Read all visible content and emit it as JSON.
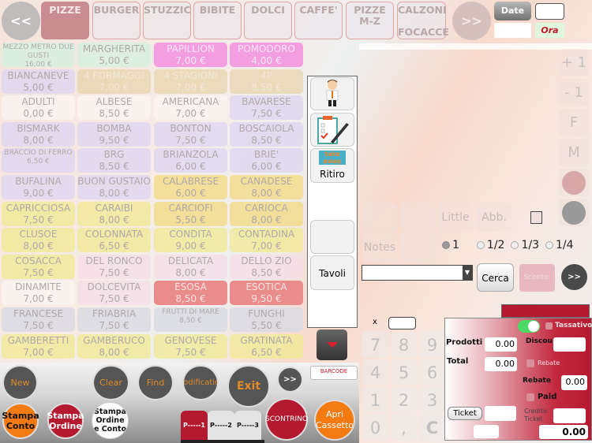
{
  "nav": {
    "prev": "<<",
    "next": ">>"
  },
  "categories": [
    "PIZZE",
    "BURGER",
    "STUZZIC",
    "BIBITE",
    "DOLCI",
    "CAFFE'",
    "PIZZE\nM-Z",
    "CALZONI\n\nFOCACCE"
  ],
  "datetime": {
    "date_label": "Date",
    "date_value": "",
    "time_label": "Ora",
    "time_value": ""
  },
  "products": [
    {
      "name": "MEZZO METRO DUE GUSTI",
      "price": "16,00 €",
      "c": "c-green",
      "s": 1
    },
    {
      "name": "MARGHERITA",
      "price": "5,00 €",
      "c": "c-green"
    },
    {
      "name": "PAPILLION",
      "price": "7,00 €",
      "c": "c-pink"
    },
    {
      "name": "POMODORO",
      "price": "4,00 €",
      "c": "c-pink"
    },
    {
      "name": "BIANCANEVE",
      "price": "5,00 €",
      "c": "c-lav"
    },
    {
      "name": "4 FORMAGGI",
      "price": "7,00 €",
      "c": "c-tan"
    },
    {
      "name": "4 STAGIONI",
      "price": "7,00 €",
      "c": "c-tan"
    },
    {
      "name": "4P",
      "price": "8,50 €",
      "c": "c-tan"
    },
    {
      "name": "ADULTI",
      "price": "0,00 €",
      "c": "c-white"
    },
    {
      "name": "ALBESE",
      "price": "8,50 €",
      "c": "c-white"
    },
    {
      "name": "AMERICANA",
      "price": "7,00 €",
      "c": "c-white"
    },
    {
      "name": "BAVARESE",
      "price": "7,50 €",
      "c": "c-lav"
    },
    {
      "name": "BISMARK",
      "price": "8,00 €",
      "c": "c-lav"
    },
    {
      "name": "BOMBA",
      "price": "9,50 €",
      "c": "c-lav"
    },
    {
      "name": "BONTON",
      "price": "7,50 €",
      "c": "c-lav"
    },
    {
      "name": "BOSCAIOLA",
      "price": "8,50 €",
      "c": "c-lav"
    },
    {
      "name": "BRACCIO DI FERRO",
      "price": "6,50 €",
      "c": "c-lav",
      "s": 1
    },
    {
      "name": "BRG",
      "price": "8,50 €",
      "c": "c-lav"
    },
    {
      "name": "BRIANZOLA",
      "price": "6,00 €",
      "c": "c-lav"
    },
    {
      "name": "BRIE'",
      "price": "6,00 €",
      "c": "c-lav"
    },
    {
      "name": "BUFALINA",
      "price": "9,00 €",
      "c": "c-lav"
    },
    {
      "name": "BUON GUSTAIO",
      "price": "8,00 €",
      "c": "c-lav"
    },
    {
      "name": "CALABRESE",
      "price": "6,00 €",
      "c": "c-yel2"
    },
    {
      "name": "CANADESE",
      "price": "8,00 €",
      "c": "c-yel2"
    },
    {
      "name": "CAPRICCIOSA",
      "price": "7,50 €",
      "c": "c-yel"
    },
    {
      "name": "CARAIBI",
      "price": "8,00 €",
      "c": "c-yel"
    },
    {
      "name": "CARCIOFI",
      "price": "5,50 €",
      "c": "c-yel2"
    },
    {
      "name": "CARIOCA",
      "price": "8,00 €",
      "c": "c-yel2"
    },
    {
      "name": "CLUSOE",
      "price": "8,00 €",
      "c": "c-yel"
    },
    {
      "name": "COLONNATA",
      "price": "6,50 €",
      "c": "c-yel"
    },
    {
      "name": "CONDITA",
      "price": "9,00 €",
      "c": "c-yel"
    },
    {
      "name": "CONTADINA",
      "price": "7,00 €",
      "c": "c-yel"
    },
    {
      "name": "COSACCA",
      "price": "7,50 €",
      "c": "c-yel"
    },
    {
      "name": "DEL RONCO",
      "price": "7,50 €",
      "c": "c-rose"
    },
    {
      "name": "DELICATA",
      "price": "8,00 €",
      "c": "c-rose"
    },
    {
      "name": "DELLO ZIO",
      "price": "8,50 €",
      "c": "c-rose"
    },
    {
      "name": "DINAMITE",
      "price": "7,00 €",
      "c": "c-white"
    },
    {
      "name": "DOLCEVITA",
      "price": "7,50 €",
      "c": "c-rose"
    },
    {
      "name": "ESOSA",
      "price": "8,50 €",
      "c": "c-red"
    },
    {
      "name": "ESOTICA",
      "price": "9,50 €",
      "c": "c-red"
    },
    {
      "name": "FRANCESE",
      "price": "7,50 €",
      "c": "c-grey"
    },
    {
      "name": "FRIABRIA",
      "price": "7,50 €",
      "c": "c-grey"
    },
    {
      "name": "FRUTTI DI MARE",
      "price": "8,50 €",
      "c": "c-grey",
      "s": 1
    },
    {
      "name": "FUNGHI",
      "price": "5,50 €",
      "c": "c-grey"
    },
    {
      "name": "GAMBERETTI",
      "price": "7,00 €",
      "c": "c-yel"
    },
    {
      "name": "GAMBERUCO",
      "price": "8,00 €",
      "c": "c-yel"
    },
    {
      "name": "GENOVESE",
      "price": "7,50 €",
      "c": "c-yel"
    },
    {
      "name": "GRATINATA",
      "price": "6,50 €",
      "c": "c-yel"
    }
  ],
  "side_panel": {
    "ritiro": "Ritiro",
    "tavoli": "Tavoli",
    "icons": [
      "waiter-icon",
      "clipboard-pen-icon",
      "takeaway-icon"
    ],
    "takeaway_text": "take away"
  },
  "right_buttons": [
    "+ 1",
    "- 1",
    "F",
    "M"
  ],
  "modifiers": {
    "little": "Little",
    "abb": "Abb.",
    "notes": "Notes",
    "fractions": [
      "1",
      "1/2",
      "1/3",
      "1/4"
    ],
    "selected_fraction": "1"
  },
  "search": {
    "cerca": "Cerca",
    "sconto": "Sconto:",
    "next": ">>"
  },
  "keypad": {
    "x_label": "x",
    "keys": [
      "7",
      "8",
      "9",
      "4",
      "5",
      "6",
      "1",
      "2",
      "3",
      "0",
      ",",
      "C"
    ]
  },
  "totals": {
    "tassativo": "Tassativo",
    "prodotti_label": "Prodotti",
    "prodotti": "0.00",
    "discount_label": "Discou",
    "total_label": "Total",
    "total": "0.00",
    "rebate_check": "Rebate",
    "rebate_label": "Rebate",
    "rebate": "0.00",
    "paid": "Paid",
    "ticket": "Ticket",
    "credito_ticket": "Credito\nTicket",
    "grand_total": "0.00",
    "toggle_on": true
  },
  "toolbar": {
    "new": "New",
    "clear": "Clear",
    "find": "Find",
    "modification": "Modification",
    "exit": "Exit",
    "more": ">>",
    "barcode": "BARCODE",
    "stampa_conto": "Stampa Conto",
    "stampa_ordine": "Stampa Ordine",
    "stampa_ordine_conto": "Stampa Ordine e Conto",
    "scontrino": "SCONTRINO",
    "apri_cassetto": "Apri Cassetto",
    "pages": [
      "P-----1",
      "P-----2",
      "P-----3"
    ],
    "active_page": 0
  },
  "colors": {
    "accent_red": "#b5192f",
    "orange": "#f47a12",
    "toolbar_dark": "#555555",
    "toggle": "#4cd964"
  }
}
